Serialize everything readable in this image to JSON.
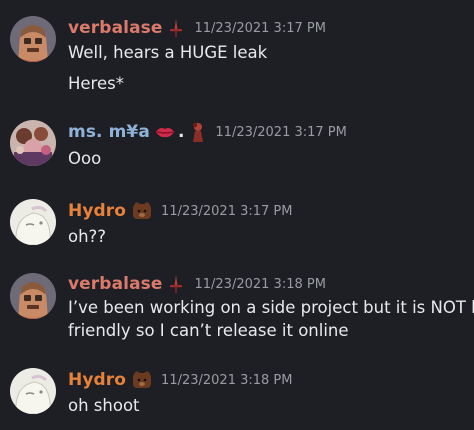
{
  "colors": {
    "background": "#1e1f24",
    "verbalase_name": "#d97a6c",
    "mya_name": "#8fb3d8",
    "hydro_name": "#e8813a",
    "timestamp": "#9a9ca3",
    "text": "#e8e9ec"
  },
  "messages": [
    {
      "author": "verbalase",
      "timestamp": "11/23/2021 3:17 PM",
      "role_icon": "dagger-icon",
      "avatar": "verbalase-avatar",
      "lines": [
        "Well, hears a HUGE leak",
        "Heres*"
      ]
    },
    {
      "author": "ms. m¥a",
      "name_badges": [
        "lips-emoji",
        "."
      ],
      "timestamp": "11/23/2021 3:17 PM",
      "role_icon": "figure-icon",
      "avatar": "mya-avatar",
      "lines": [
        "Ooo"
      ]
    },
    {
      "author": "Hydro",
      "timestamp": "11/23/2021 3:17 PM",
      "role_icon": "bear-icon",
      "avatar": "hydro-avatar",
      "lines": [
        "oh??"
      ]
    },
    {
      "author": "verbalase",
      "timestamp": "11/23/2021 3:18 PM",
      "role_icon": "dagger-icon",
      "avatar": "verbalase-avatar",
      "lines": [
        "I’ve been working on a side project but it is NOT kid",
        "friendly so I can’t release it online"
      ]
    },
    {
      "author": "Hydro",
      "timestamp": "11/23/2021 3:18 PM",
      "role_icon": "bear-icon",
      "avatar": "hydro-avatar",
      "lines": [
        "oh shoot"
      ]
    }
  ]
}
